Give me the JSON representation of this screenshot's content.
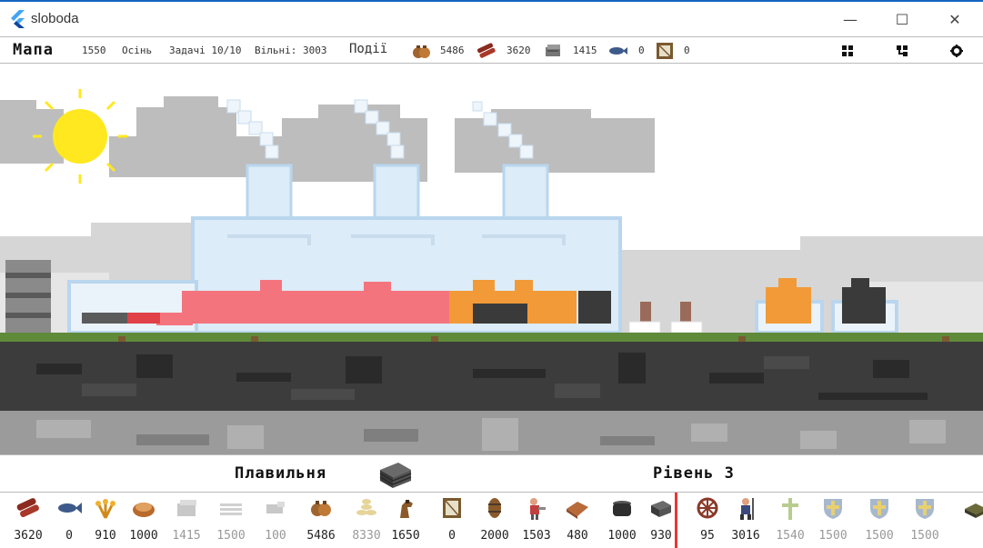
{
  "window": {
    "title": "sloboda",
    "minimize_glyph": "—",
    "maximize_glyph": "☐",
    "close_glyph": "✕"
  },
  "topbar": {
    "map_label": "Мапа",
    "year": "1550",
    "season": "Осінь",
    "tasks": "Задачі 10/10",
    "free": "Вільні: 3003",
    "events_label": "Події",
    "resources": [
      {
        "icon": "money-bags-icon",
        "value": "5486"
      },
      {
        "icon": "logs-icon",
        "value": "3620"
      },
      {
        "icon": "stone-icon",
        "value": "1415"
      },
      {
        "icon": "fish-icon",
        "value": "0"
      },
      {
        "icon": "frame-icon",
        "value": "0"
      }
    ],
    "buttons": [
      "grid-icon",
      "tree-icon",
      "gear-icon"
    ]
  },
  "building": {
    "name": "Плавильня",
    "icon": "ingot-stack-icon",
    "level": "Рівень 3"
  },
  "resources_bar": [
    {
      "name": "logs-icon",
      "value": "3620",
      "dim": false
    },
    {
      "name": "fish-icon",
      "value": "0",
      "dim": false
    },
    {
      "name": "wheat-icon",
      "value": "910",
      "dim": false
    },
    {
      "name": "bread-basket-icon",
      "value": "1000",
      "dim": false
    },
    {
      "name": "stone-block-icon",
      "value": "1415",
      "dim": true
    },
    {
      "name": "planks-icon",
      "value": "1500",
      "dim": true
    },
    {
      "name": "iron-ore-icon",
      "value": "100",
      "dim": true
    },
    {
      "name": "money-bags-icon",
      "value": "5486",
      "dim": false
    },
    {
      "name": "coins-icon",
      "value": "8330",
      "dim": true
    },
    {
      "name": "horse-icon",
      "value": "1650",
      "dim": false
    },
    {
      "name": "frame-icon",
      "value": "0",
      "dim": false
    },
    {
      "name": "barrel-icon",
      "value": "2000",
      "dim": false
    },
    {
      "name": "worker-icon",
      "value": "1503",
      "dim": false
    },
    {
      "name": "leather-icon",
      "value": "480",
      "dim": false
    },
    {
      "name": "pot-icon",
      "value": "1000",
      "dim": false
    },
    {
      "name": "ingots-icon",
      "value": "930",
      "dim": false
    },
    {
      "name": "wheel-icon",
      "value": "95",
      "dim": false
    },
    {
      "name": "soldier-icon",
      "value": "3016",
      "dim": false
    },
    {
      "name": "cross-icon",
      "value": "1540",
      "dim": true
    },
    {
      "name": "shield-icon",
      "value": "1500",
      "dim": true
    },
    {
      "name": "shield-icon",
      "value": "1500",
      "dim": true
    },
    {
      "name": "shield-icon",
      "value": "1500",
      "dim": true
    },
    {
      "name": "crate-icon",
      "value": "",
      "dim": false
    }
  ],
  "colors": {
    "sky": "#ffffff",
    "cloud": "#b9b9b9",
    "sun": "#ffe81f",
    "glass": "#dcecf8",
    "glass_edge": "#b9d6ee",
    "molten": "#f4747e",
    "fire": "#f29a37",
    "coal": "#3a3a3a",
    "grass": "#5f8a3a",
    "ground_dark": "#3c3c3c",
    "ground_light": "#9b9b9b",
    "divider": "#e53935"
  }
}
